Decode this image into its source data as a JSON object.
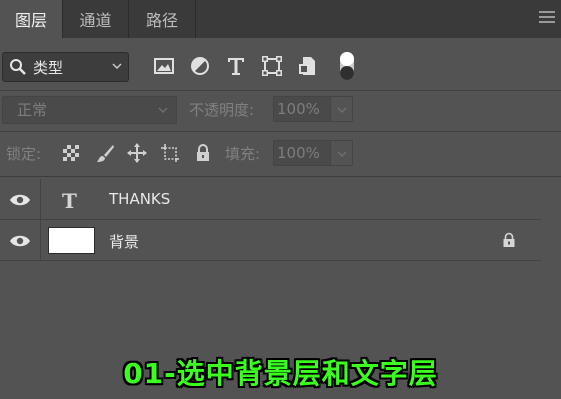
{
  "tabs": [
    {
      "label": "图层",
      "active": true
    },
    {
      "label": "通道",
      "active": false
    },
    {
      "label": "路径",
      "active": false
    }
  ],
  "filter": {
    "kind_label": "类型",
    "icons": [
      "image-filter-icon",
      "adjustment-filter-icon",
      "type-filter-icon",
      "shape-filter-icon",
      "smart-object-filter-icon"
    ]
  },
  "blend": {
    "mode": "正常",
    "opacity_label": "不透明度:",
    "opacity_value": "100%"
  },
  "lock": {
    "label": "锁定:",
    "fill_label": "填充:",
    "fill_value": "100%"
  },
  "layers": [
    {
      "name": "THANKS",
      "type": "text",
      "visible": true,
      "locked": false
    },
    {
      "name": "背景",
      "type": "background",
      "visible": true,
      "locked": true
    }
  ],
  "caption": "01-选中背景层和文字层",
  "colors": {
    "panel_bg": "#535353",
    "tabbar_bg": "#3a3a3a",
    "caption_green": "#3bff1f"
  }
}
